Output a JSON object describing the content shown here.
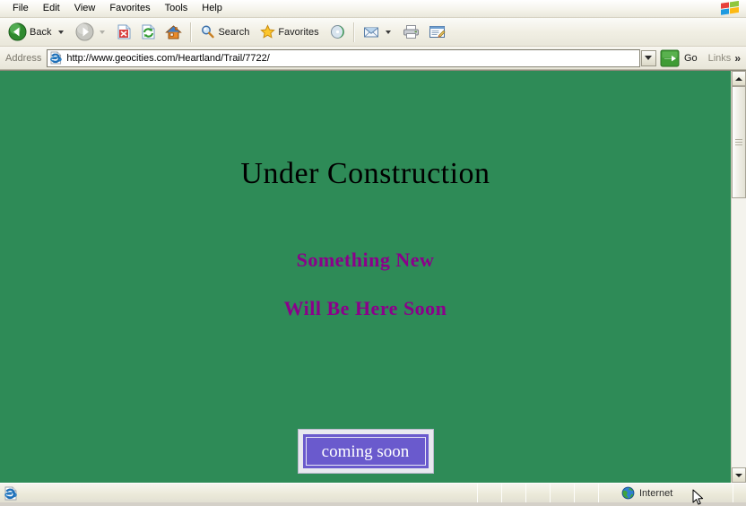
{
  "menubar": {
    "items": [
      {
        "label": "File"
      },
      {
        "label": "Edit"
      },
      {
        "label": "View"
      },
      {
        "label": "Favorites"
      },
      {
        "label": "Tools"
      },
      {
        "label": "Help"
      }
    ],
    "brand_icon": "windows-flag-logo"
  },
  "toolbar": {
    "back_label": "Back",
    "back_icon": "back-arrow-icon",
    "forward_icon": "forward-arrow-icon",
    "stop_icon": "stop-icon",
    "refresh_icon": "refresh-icon",
    "home_icon": "home-icon",
    "search_label": "Search",
    "search_icon": "magnifier-icon",
    "favorites_label": "Favorites",
    "favorites_icon": "star-icon",
    "media_icon": "media-icon",
    "mail_icon": "mail-icon",
    "print_icon": "print-icon",
    "edit_icon": "edit-page-icon"
  },
  "address": {
    "label": "Address",
    "page_icon": "ie-page-icon",
    "url": "http://www.geocities.com/Heartland/Trail/7722/",
    "placeholder": "http://",
    "dropdown_icon": "chevron-down-icon",
    "go_label": "Go",
    "go_icon": "go-arrow-icon",
    "links_label": "Links",
    "overflow_icon": "double-chevron-icon"
  },
  "page": {
    "background_color": "#2e8b57",
    "heading": "Under Construction",
    "heading_color": "#000000",
    "subheading_1": "Something New",
    "subheading_2": "Will Be Here Soon",
    "subheading_color": "#8b008b",
    "button": {
      "label": "coming soon",
      "fill_color": "#6a5acd",
      "text_color": "#ffffff",
      "frame_color": "#e8e8ef"
    }
  },
  "scrollbar": {
    "up_icon": "scroll-up-arrow-icon",
    "down_icon": "scroll-down-arrow-icon",
    "thumb_icon": "scroll-thumb-grip"
  },
  "statusbar": {
    "page_icon": "ie-document-icon",
    "message": "",
    "zone_icon": "globe-icon",
    "zone_label": "Internet"
  }
}
